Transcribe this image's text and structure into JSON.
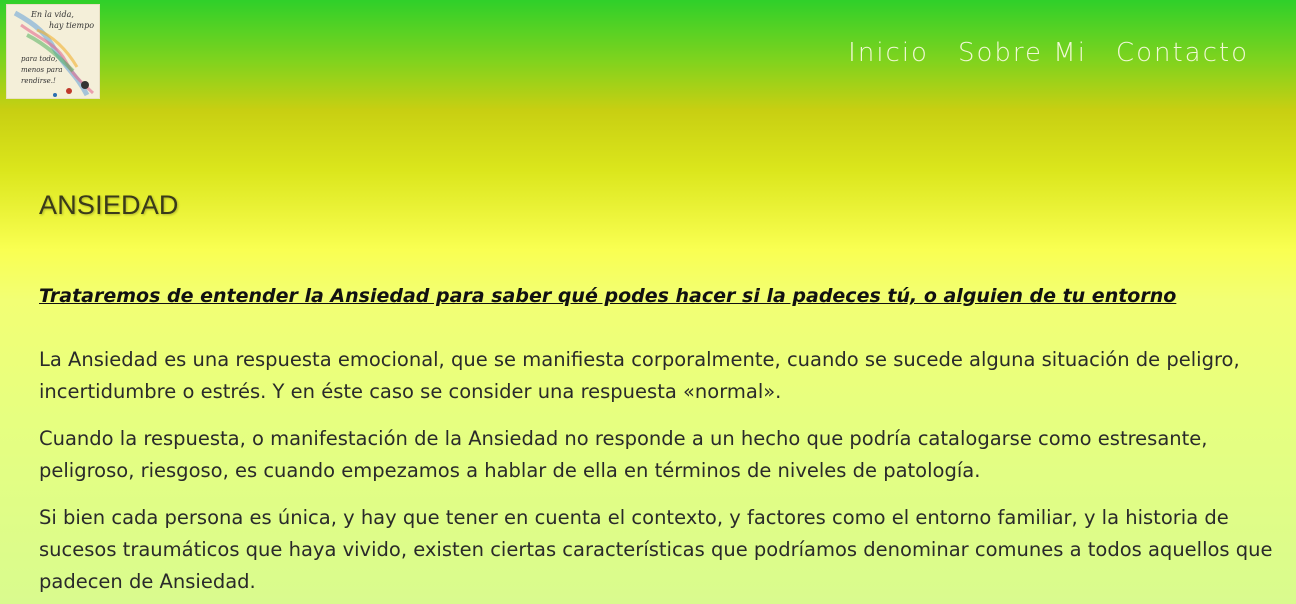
{
  "logo": {
    "lines": [
      "En la vida,",
      "hay tiempo",
      "para todo,",
      "menos para",
      "rendirse.!"
    ]
  },
  "nav": {
    "items": [
      "Inicio",
      "Sobre Mi",
      "Contacto"
    ]
  },
  "article": {
    "title": "ANSIEDAD",
    "subtitle": "Trataremos de entender la Ansiedad para saber qué podes hacer si la padeces tú, o alguien de tu entorno ",
    "paragraphs": [
      "La Ansiedad es una respuesta emocional, que se manifiesta corporalmente, cuando se sucede alguna situación de peligro, incertidumbre o estrés. Y en éste caso se consider una respuesta «normal».",
      "Cuando la respuesta, o manifestación de la Ansiedad no responde a un hecho que podría catalogarse como estresante, peligroso, riesgoso, es cuando empezamos a hablar de ella en términos de niveles de patología.",
      "Si bien cada persona es única, y hay que  tener en cuenta el contexto, y factores como el entorno familiar, y la historia de sucesos traumáticos que haya vivido, existen ciertas características que podríamos denominar comunes a todos aquellos que padecen de Ansiedad."
    ]
  },
  "colors": {
    "header_top": "#2fd02a",
    "body_yellow": "#f9ff52",
    "nav_text": "#f1f8d6"
  }
}
